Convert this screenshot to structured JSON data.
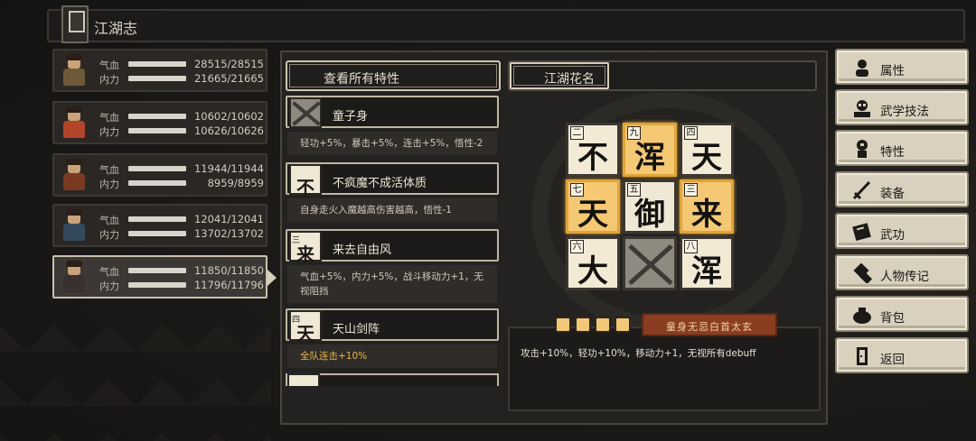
{
  "window": {
    "title": "江湖志"
  },
  "characters": [
    {
      "hp_label": "气血",
      "hp": "28515/28515",
      "mp_label": "内力",
      "mp": "21665/21665",
      "robe": "#6e5a38",
      "hair": "#2a1e16"
    },
    {
      "hp_label": "气血",
      "hp": "10602/10602",
      "mp_label": "内力",
      "mp": "10626/10626",
      "robe": "#b2442a",
      "hair": "#3a2718"
    },
    {
      "hp_label": "气血",
      "hp": "11944/11944",
      "mp_label": "内力",
      "mp": "8959/8959",
      "robe": "#7a3a22",
      "hair": "#2a1e16"
    },
    {
      "hp_label": "气血",
      "hp": "12041/12041",
      "mp_label": "内力",
      "mp": "13702/13702",
      "robe": "#344a5c",
      "hair": "#8a7040"
    },
    {
      "hp_label": "气血",
      "hp": "11850/11850",
      "mp_label": "内力",
      "mp": "11796/11796",
      "robe": "#3a3030",
      "hair": "#1a1414"
    }
  ],
  "traits_panel": {
    "header": "查看所有特性",
    "traits": [
      {
        "name": "童子身",
        "glyph": "",
        "corner": "",
        "desc": "轻功+5%，暴击+5%，连击+5%，悟性-2",
        "gold": false
      },
      {
        "name": "不疯魔不成活体质",
        "glyph": "不",
        "corner": "",
        "desc": "自身走火入魔越高伤害越高，悟性-1",
        "gold": false
      },
      {
        "name": "来去自由风",
        "glyph": "来",
        "corner": "三",
        "desc": "气血+5%，内力+5%，战斗移动力+1，无视阻挡",
        "gold": false
      },
      {
        "name": "天山剑阵",
        "glyph": "天",
        "corner": "四",
        "desc": "全队连击+10%",
        "gold": true
      }
    ]
  },
  "name_panel": {
    "header": "江湖花名",
    "grid": [
      {
        "char": "不",
        "num": "二",
        "state": "plain"
      },
      {
        "char": "浑",
        "num": "九",
        "state": "lit"
      },
      {
        "char": "天",
        "num": "四",
        "state": "plain"
      },
      {
        "char": "天",
        "num": "七",
        "state": "lit"
      },
      {
        "char": "御",
        "num": "五",
        "state": "center"
      },
      {
        "char": "来",
        "num": "三",
        "state": "lit"
      },
      {
        "char": "大",
        "num": "六",
        "state": "plain"
      },
      {
        "char": "",
        "num": "",
        "state": "gray"
      },
      {
        "char": "浑",
        "num": "八",
        "state": "plain"
      }
    ],
    "combo_name": "童身无忌白首太玄",
    "combo_desc": "攻击+10%，轻功+10%，移动力+1，无视所有debuff"
  },
  "menu": [
    {
      "label": "属性",
      "icon": "person-icon"
    },
    {
      "label": "武学技法",
      "icon": "martial-icon"
    },
    {
      "label": "特性",
      "icon": "trait-icon"
    },
    {
      "label": "装备",
      "icon": "sword-icon"
    },
    {
      "label": "武功",
      "icon": "book-icon"
    },
    {
      "label": "人物传记",
      "icon": "scroll-icon"
    },
    {
      "label": "背包",
      "icon": "bag-icon"
    },
    {
      "label": "返回",
      "icon": "door-icon"
    }
  ],
  "colors": {
    "accent_gold": "#f5c873",
    "combo_red": "#8a3d20",
    "panel_border": "#cfc6b2"
  }
}
